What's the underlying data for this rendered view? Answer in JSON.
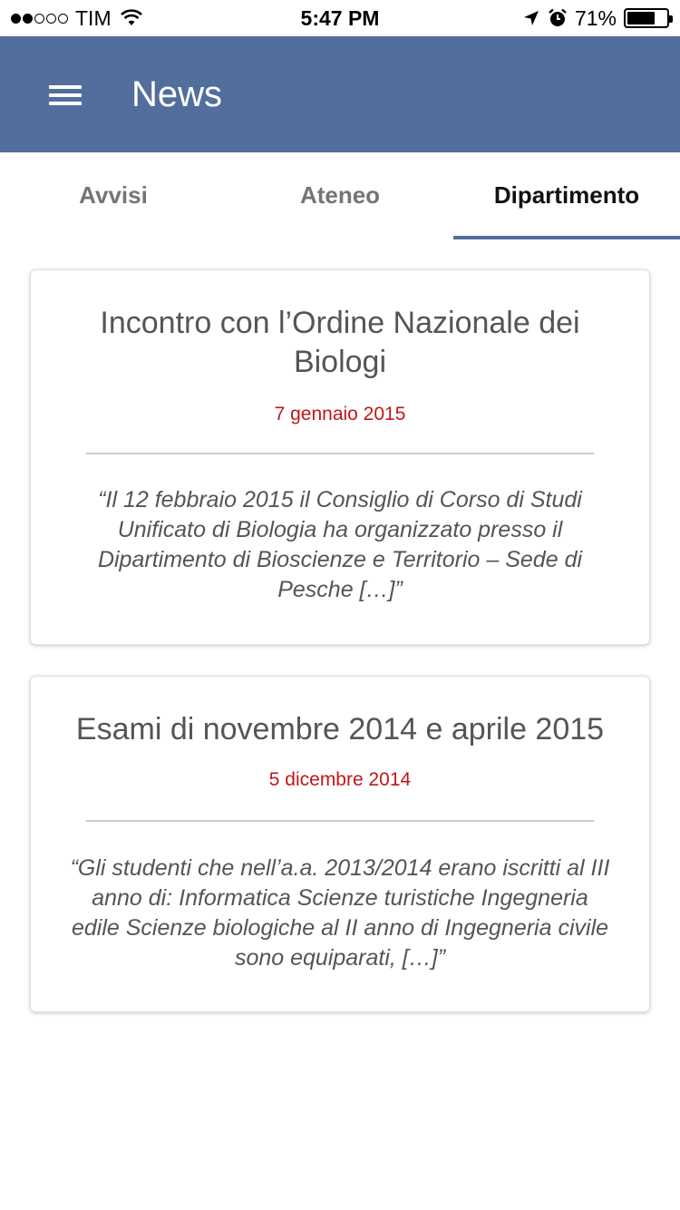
{
  "status_bar": {
    "carrier": "TIM",
    "time": "5:47 PM",
    "battery_percent": "71%",
    "battery_level": 0.71,
    "signal_bars_filled": 2,
    "signal_bars_total": 5
  },
  "app_bar": {
    "title": "News",
    "menu_icon": "hamburger-menu-icon",
    "color": "#526e9c"
  },
  "tabs": [
    {
      "label": "Avvisi",
      "active": false
    },
    {
      "label": "Ateneo",
      "active": false
    },
    {
      "label": "Dipartimento",
      "active": true
    }
  ],
  "news": [
    {
      "title": "Incontro con l’Ordine Nazionale dei Biologi",
      "date": "7 gennaio 2015",
      "excerpt": "“Il 12 febbraio 2015 il Consiglio di Corso di Studi Unificato di Biologia ha organizzato presso il Dipartimento di Bioscienze e Territorio – Sede di Pesche […]”"
    },
    {
      "title": "Esami di novembre 2014 e aprile 2015",
      "date": "5 dicembre 2014",
      "excerpt": "“Gli studenti che nell’a.a. 2013/2014 erano iscritti al III anno di: Informatica Scienze turistiche Ingegneria edile Scienze biologiche al II anno di Ingegneria civile sono equiparati, […]”"
    }
  ],
  "colors": {
    "accent": "#526e9c",
    "date": "#c0171b"
  }
}
